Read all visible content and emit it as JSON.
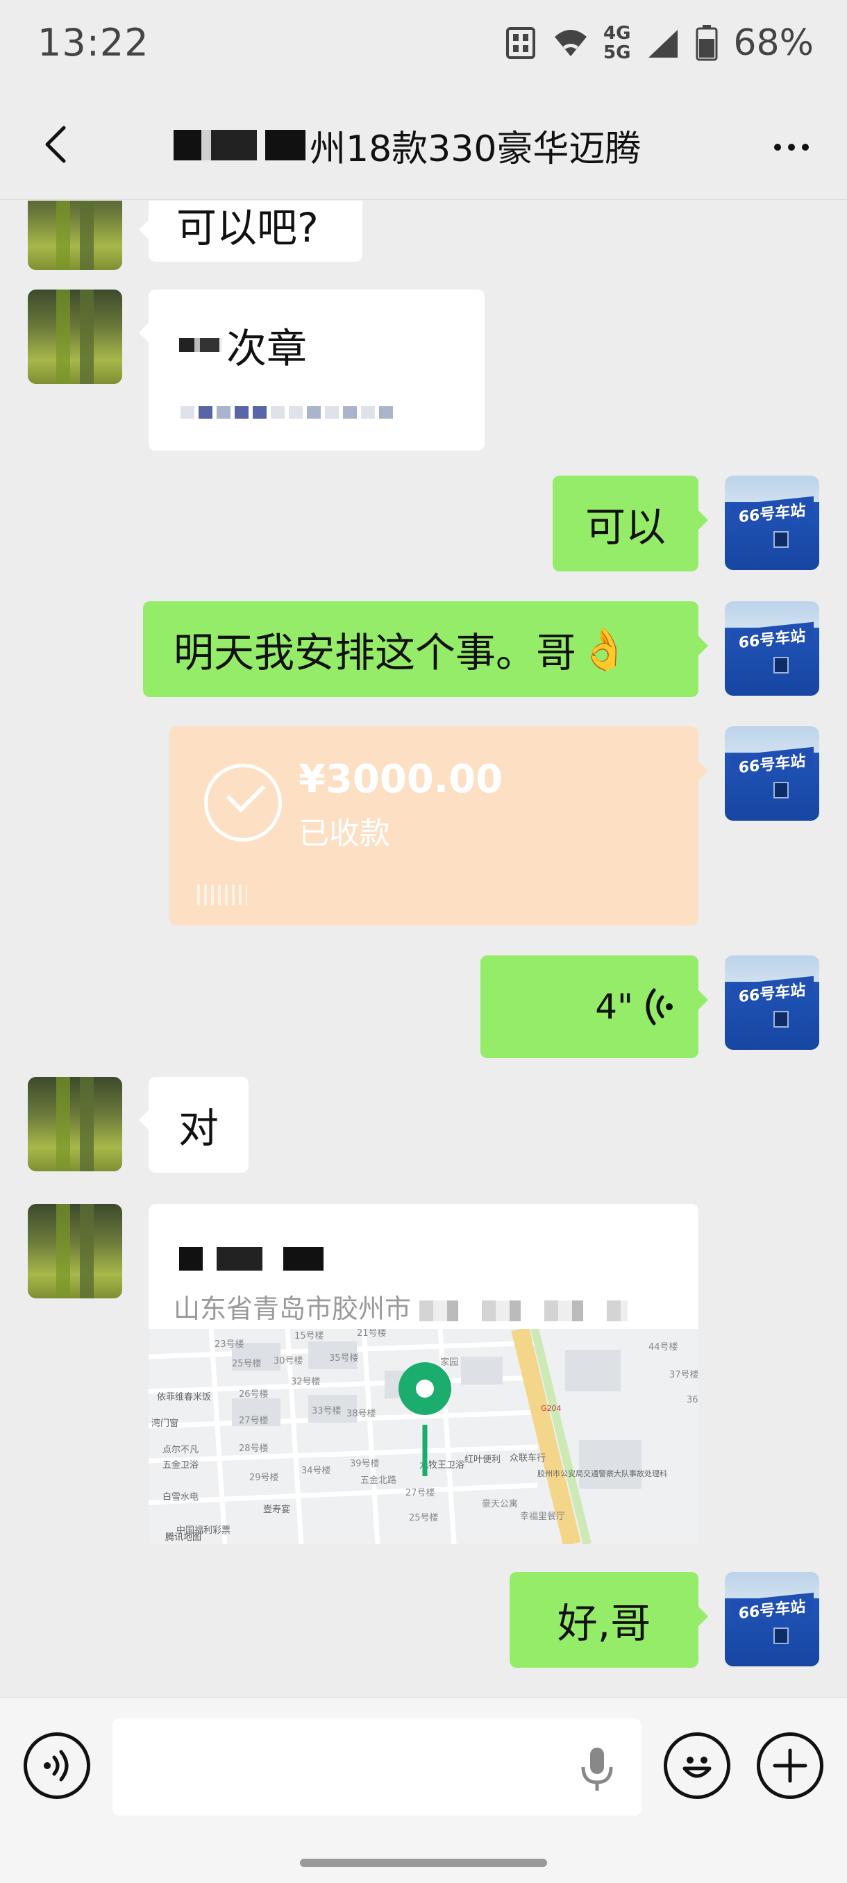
{
  "status_bar": {
    "time": "13:22",
    "network_top": "4G",
    "network_bottom": "5G",
    "battery_percent": "68%",
    "icons": [
      "sim-card-icon",
      "wifi-icon",
      "signal-icon",
      "battery-icon"
    ]
  },
  "header": {
    "title": "州18款330豪华迈腾",
    "back_icon": "chevron-left-icon",
    "more_icon": "more-dots-icon"
  },
  "messages": [
    {
      "sender": "other",
      "type": "text",
      "text": "可以吧?"
    },
    {
      "sender": "other",
      "type": "text",
      "text": "次章"
    },
    {
      "sender": "self",
      "type": "text",
      "text": "可以"
    },
    {
      "sender": "self",
      "type": "text",
      "text": "明天我安排这个事。哥"
    },
    {
      "sender": "self",
      "type": "transfer",
      "amount": "¥3000.00",
      "status": "已收款"
    },
    {
      "sender": "self",
      "type": "voice",
      "duration": "4\""
    },
    {
      "sender": "other",
      "type": "text",
      "text": "对"
    },
    {
      "sender": "other",
      "type": "location",
      "address": "山东省青岛市胶州市",
      "map_labels": [
        "21号楼",
        "15号楼",
        "23号楼",
        "25号楼",
        "30号楼",
        "35号楼",
        "26号楼",
        "32号楼",
        "27号楼",
        "33号楼",
        "28号楼",
        "38号楼",
        "29号楼",
        "34号楼",
        "39号楼",
        "五金北路",
        "九牧王卫浴",
        "红叶便利",
        "众联车行",
        "胶州市公安局交通警察大队事故处理科",
        "27号楼",
        "豪天公寓",
        "幸福里餐厅",
        "25号楼",
        "44号楼",
        "37号楼",
        "36",
        "依菲维春米饭",
        "湾门窗",
        "点尔不凡",
        "五金卫浴",
        "白雪水电",
        "壹寿宴",
        "中国福利彩票",
        "腾讯地图",
        "G204",
        "家园"
      ]
    },
    {
      "sender": "self",
      "type": "text",
      "text": "好,哥"
    }
  ],
  "emoji": "👌",
  "self_avatar_sign": "66号车站",
  "input_bar": {
    "voice_icon": "voice-mode-icon",
    "mic_icon": "microphone-icon",
    "emoji_icon": "emoji-icon",
    "plus_icon": "plus-icon"
  },
  "colors": {
    "background": "#ededed",
    "self_bubble": "#95ec69",
    "other_bubble": "#ffffff",
    "transfer_card": "#fde0c4",
    "map_pin": "#1aad6e"
  }
}
